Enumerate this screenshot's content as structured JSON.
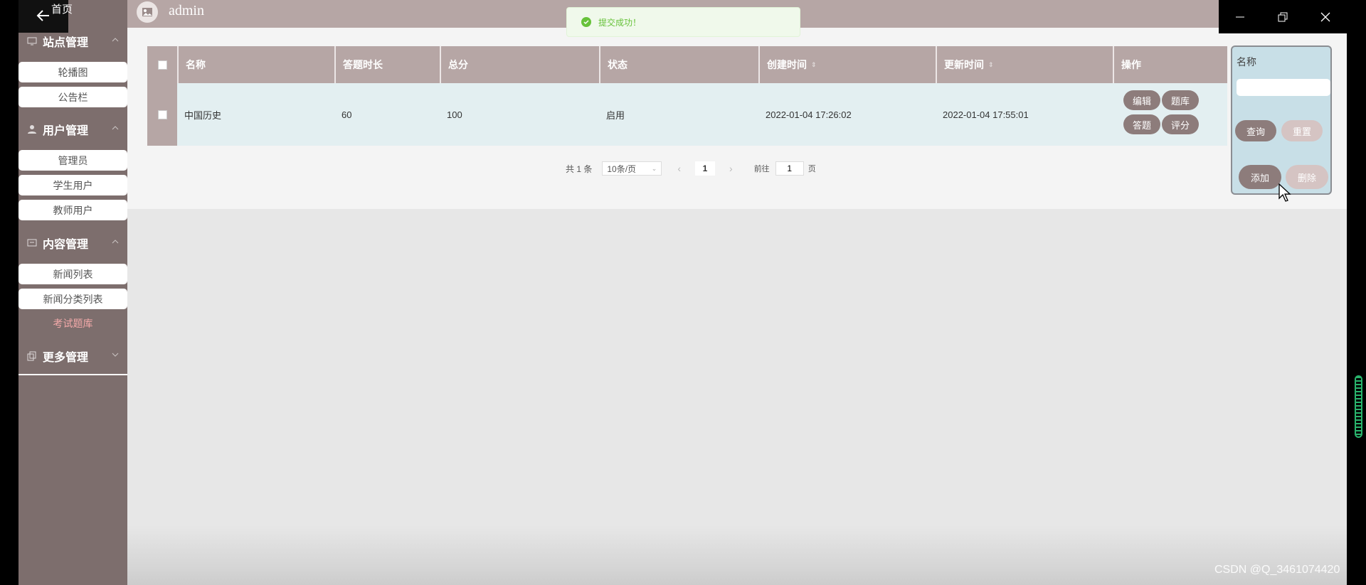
{
  "window": {
    "minimize_icon": "minimize-icon",
    "restore_icon": "restore-icon",
    "close_icon": "close-icon"
  },
  "sidebar": {
    "back_icon": "arrow-left-icon",
    "home_label": "首页",
    "groups": [
      {
        "label": "站点管理",
        "items": [
          "轮播图",
          "公告栏"
        ]
      },
      {
        "label": "用户管理",
        "items": [
          "管理员",
          "学生用户",
          "教师用户"
        ]
      },
      {
        "label": "内容管理",
        "items": [
          "新闻列表",
          "新闻分类列表",
          "考试题库"
        ]
      },
      {
        "label": "更多管理",
        "items": []
      }
    ],
    "active_item": "考试题库"
  },
  "header": {
    "username": "admin"
  },
  "toast": {
    "message": "提交成功！",
    "type": "success"
  },
  "table": {
    "headers": [
      "名称",
      "答题时长",
      "总分",
      "状态",
      "创建时间",
      "更新时间",
      "操作"
    ],
    "rows": [
      {
        "name": "中国历史",
        "duration": "60",
        "score": "100",
        "status": "启用",
        "created": "2022-01-04 17:26:02",
        "updated": "2022-01-04 17:55:01"
      }
    ],
    "actions": [
      "编辑",
      "题库",
      "答题",
      "评分"
    ]
  },
  "pagination": {
    "total_prefix": "共 1 条",
    "page_size": "10条/页",
    "current_page": "1",
    "goto_label": "前往",
    "goto_value": "1",
    "goto_suffix": "页"
  },
  "search_panel": {
    "name_label": "名称",
    "name_value": "",
    "query_button": "查询",
    "reset_button": "重置",
    "add_button": "添加",
    "delete_button": "删除"
  },
  "colors": {
    "sidebar_bg": "#7d6e6d",
    "header_bg": "#b6a6a5",
    "row_bg": "#e3eff1",
    "button_dark": "#8d7c7b",
    "button_light": "#d5c4c3",
    "search_panel_bg": "#c8dfe7",
    "active_item": "#f3a9a9",
    "success": "#67c23a"
  },
  "watermark": "CSDN @Q_3461074420"
}
